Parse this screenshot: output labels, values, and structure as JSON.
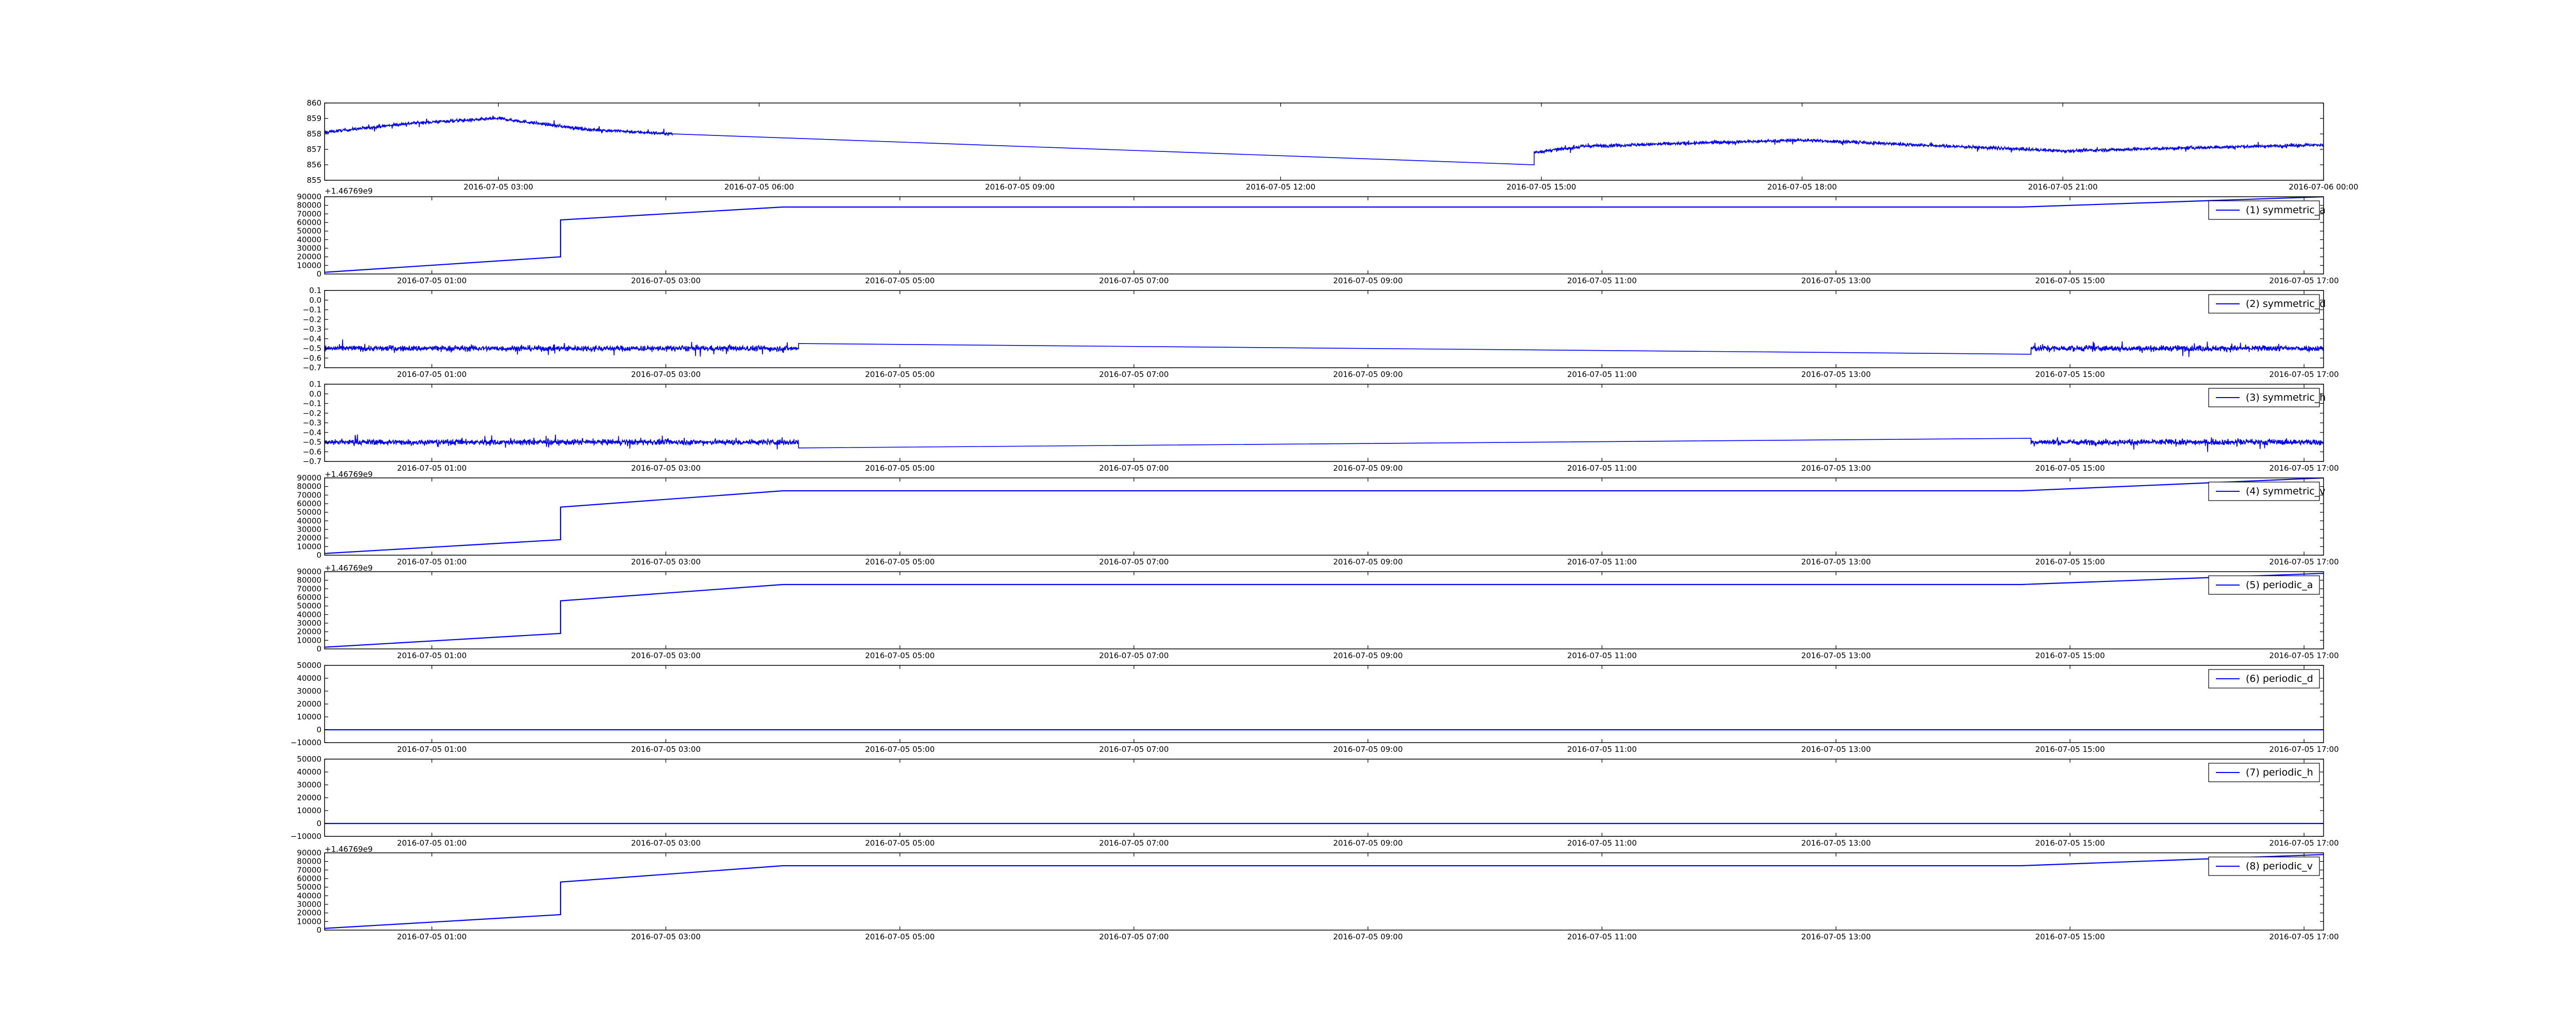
{
  "chart_data": [
    {
      "type": "line",
      "id": "raw",
      "yticks": [
        855,
        856,
        857,
        858,
        859,
        860
      ],
      "ylim": [
        855,
        860
      ],
      "xlim": [
        "2016-07-05T01:00",
        "2016-07-06T00:00"
      ],
      "xticks": [
        "2016-07-05 03:00",
        "2016-07-05 06:00",
        "2016-07-05 09:00",
        "2016-07-05 12:00",
        "2016-07-05 15:00",
        "2016-07-05 18:00",
        "2016-07-05 21:00",
        "2016-07-06 00:00"
      ],
      "offset_text": "+1.46769e9",
      "legend": "",
      "series": [
        {
          "color": "#0000ff",
          "noise": 0.18,
          "segments": [
            {
              "from": "2016-07-05T01:00",
              "to": "2016-07-05T05:00",
              "noisy": true,
              "x": [
                "2016-07-05T01:00",
                "2016-07-05T02:00",
                "2016-07-05T03:00",
                "2016-07-05T04:00",
                "2016-07-05T05:00"
              ],
              "y": [
                858.1,
                858.7,
                859.0,
                858.3,
                858.0
              ]
            },
            {
              "from": "2016-07-05T05:00",
              "to": "2016-07-05T14:55",
              "noisy": false,
              "x": [
                "2016-07-05T05:00",
                "2016-07-05T14:55"
              ],
              "y": [
                858.0,
                856.0
              ]
            },
            {
              "from": "2016-07-05T14:55",
              "to": "2016-07-06T00:00",
              "noisy": true,
              "x": [
                "2016-07-05T14:55",
                "2016-07-05T15:30",
                "2016-07-05T18:00",
                "2016-07-05T21:00",
                "2016-07-06T00:00"
              ],
              "y": [
                856.8,
                857.2,
                857.6,
                856.9,
                857.3
              ]
            }
          ]
        }
      ]
    },
    {
      "type": "line",
      "id": "1",
      "yticks": [
        0,
        10000,
        20000,
        30000,
        40000,
        50000,
        60000,
        70000,
        80000,
        90000
      ],
      "ylim": [
        0,
        90000
      ],
      "xlim": [
        "2016-07-05T00:05",
        "2016-07-05T17:10"
      ],
      "xticks": [
        "2016-07-05 01:00",
        "2016-07-05 03:00",
        "2016-07-05 05:00",
        "2016-07-05 07:00",
        "2016-07-05 09:00",
        "2016-07-05 11:00",
        "2016-07-05 13:00",
        "2016-07-05 15:00",
        "2016-07-05 17:00"
      ],
      "offset_text": "",
      "legend": "(1) symmetric_a",
      "series": [
        {
          "color": "#0000ff",
          "noise": 0,
          "x": [
            "2016-07-05T00:05",
            "2016-07-05T02:06",
            "2016-07-05T02:06",
            "2016-07-05T04:00",
            "2016-07-05T14:35",
            "2016-07-05T17:10"
          ],
          "y": [
            2000,
            20000,
            63000,
            78000,
            78000,
            90000
          ]
        }
      ]
    },
    {
      "type": "line",
      "id": "2",
      "yticks": [
        -0.7,
        -0.6,
        -0.5,
        -0.4,
        -0.3,
        -0.2,
        -0.1,
        0.0,
        0.1
      ],
      "ylim": [
        -0.7,
        0.1
      ],
      "xlim": [
        "2016-07-05T00:05",
        "2016-07-05T17:10"
      ],
      "xticks": [
        "2016-07-05 01:00",
        "2016-07-05 03:00",
        "2016-07-05 05:00",
        "2016-07-05 07:00",
        "2016-07-05 09:00",
        "2016-07-05 11:00",
        "2016-07-05 13:00",
        "2016-07-05 15:00",
        "2016-07-05 17:00"
      ],
      "offset_text": "",
      "legend": "(2) symmetric_d",
      "series": [
        {
          "color": "#0000ff",
          "noise": 0.05,
          "segments": [
            {
              "from": "2016-07-05T00:05",
              "to": "2016-07-05T04:08",
              "noisy": true,
              "x": [
                "2016-07-05T00:05",
                "2016-07-05T04:08"
              ],
              "y": [
                -0.5,
                -0.5
              ]
            },
            {
              "from": "2016-07-05T04:08",
              "to": "2016-07-05T14:40",
              "noisy": false,
              "x": [
                "2016-07-05T04:08",
                "2016-07-05T14:40"
              ],
              "y": [
                -0.45,
                -0.56
              ]
            },
            {
              "from": "2016-07-05T14:40",
              "to": "2016-07-05T17:10",
              "noisy": true,
              "x": [
                "2016-07-05T14:40",
                "2016-07-05T17:10"
              ],
              "y": [
                -0.5,
                -0.5
              ]
            }
          ]
        }
      ]
    },
    {
      "type": "line",
      "id": "3",
      "yticks": [
        -0.7,
        -0.6,
        -0.5,
        -0.4,
        -0.3,
        -0.2,
        -0.1,
        0.0,
        0.1
      ],
      "ylim": [
        -0.7,
        0.1
      ],
      "xlim": [
        "2016-07-05T00:05",
        "2016-07-05T17:10"
      ],
      "xticks": [
        "2016-07-05 01:00",
        "2016-07-05 03:00",
        "2016-07-05 05:00",
        "2016-07-05 07:00",
        "2016-07-05 09:00",
        "2016-07-05 11:00",
        "2016-07-05 13:00",
        "2016-07-05 15:00",
        "2016-07-05 17:00"
      ],
      "offset_text": "",
      "legend": "(3) symmetric_h",
      "series": [
        {
          "color": "#0000ff",
          "noise": 0.05,
          "segments": [
            {
              "from": "2016-07-05T00:05",
              "to": "2016-07-05T04:08",
              "noisy": true,
              "x": [
                "2016-07-05T00:05",
                "2016-07-05T04:08"
              ],
              "y": [
                -0.5,
                -0.5
              ]
            },
            {
              "from": "2016-07-05T04:08",
              "to": "2016-07-05T14:40",
              "noisy": false,
              "x": [
                "2016-07-05T04:08",
                "2016-07-05T14:40"
              ],
              "y": [
                -0.56,
                -0.46
              ]
            },
            {
              "from": "2016-07-05T14:40",
              "to": "2016-07-05T17:10",
              "noisy": true,
              "x": [
                "2016-07-05T14:40",
                "2016-07-05T17:10"
              ],
              "y": [
                -0.5,
                -0.5
              ]
            }
          ]
        }
      ]
    },
    {
      "type": "line",
      "id": "4",
      "yticks": [
        0,
        10000,
        20000,
        30000,
        40000,
        50000,
        60000,
        70000,
        80000,
        90000
      ],
      "ylim": [
        0,
        90000
      ],
      "xlim": [
        "2016-07-05T00:05",
        "2016-07-05T17:10"
      ],
      "xticks": [
        "2016-07-05 01:00",
        "2016-07-05 03:00",
        "2016-07-05 05:00",
        "2016-07-05 07:00",
        "2016-07-05 09:00",
        "2016-07-05 11:00",
        "2016-07-05 13:00",
        "2016-07-05 15:00",
        "2016-07-05 17:00"
      ],
      "offset_text": "+1.46769e9",
      "legend": "(4) symmetric_v",
      "series": [
        {
          "color": "#0000ff",
          "noise": 0,
          "x": [
            "2016-07-05T00:05",
            "2016-07-05T02:06",
            "2016-07-05T02:06",
            "2016-07-05T04:00",
            "2016-07-05T14:35",
            "2016-07-05T17:10"
          ],
          "y": [
            2000,
            18000,
            56000,
            75000,
            75000,
            90000
          ]
        }
      ]
    },
    {
      "type": "line",
      "id": "5",
      "yticks": [
        0,
        10000,
        20000,
        30000,
        40000,
        50000,
        60000,
        70000,
        80000,
        90000
      ],
      "ylim": [
        0,
        90000
      ],
      "xlim": [
        "2016-07-05T00:05",
        "2016-07-05T17:10"
      ],
      "xticks": [
        "2016-07-05 01:00",
        "2016-07-05 03:00",
        "2016-07-05 05:00",
        "2016-07-05 07:00",
        "2016-07-05 09:00",
        "2016-07-05 11:00",
        "2016-07-05 13:00",
        "2016-07-05 15:00",
        "2016-07-05 17:00"
      ],
      "offset_text": "+1.46769e9",
      "legend": "(5) periodic_a",
      "series": [
        {
          "color": "#0000ff",
          "noise": 0,
          "x": [
            "2016-07-05T00:05",
            "2016-07-05T02:06",
            "2016-07-05T02:06",
            "2016-07-05T04:00",
            "2016-07-05T14:35",
            "2016-07-05T17:10"
          ],
          "y": [
            2000,
            18000,
            56000,
            75000,
            75000,
            88000
          ]
        }
      ]
    },
    {
      "type": "line",
      "id": "6",
      "yticks": [
        -10000,
        0,
        10000,
        20000,
        30000,
        40000,
        50000
      ],
      "ylim": [
        -10000,
        50000
      ],
      "xlim": [
        "2016-07-05T00:05",
        "2016-07-05T17:10"
      ],
      "xticks": [
        "2016-07-05 01:00",
        "2016-07-05 03:00",
        "2016-07-05 05:00",
        "2016-07-05 07:00",
        "2016-07-05 09:00",
        "2016-07-05 11:00",
        "2016-07-05 13:00",
        "2016-07-05 15:00",
        "2016-07-05 17:00"
      ],
      "offset_text": "",
      "legend": "(6) periodic_d",
      "series": [
        {
          "color": "#0000ff",
          "noise": 0,
          "x": [
            "2016-07-05T00:05",
            "2016-07-05T17:10"
          ],
          "y": [
            0,
            0
          ]
        }
      ]
    },
    {
      "type": "line",
      "id": "7",
      "yticks": [
        -10000,
        0,
        10000,
        20000,
        30000,
        40000,
        50000
      ],
      "ylim": [
        -10000,
        50000
      ],
      "xlim": [
        "2016-07-05T00:05",
        "2016-07-05T17:10"
      ],
      "xticks": [
        "2016-07-05 01:00",
        "2016-07-05 03:00",
        "2016-07-05 05:00",
        "2016-07-05 07:00",
        "2016-07-05 09:00",
        "2016-07-05 11:00",
        "2016-07-05 13:00",
        "2016-07-05 15:00",
        "2016-07-05 17:00"
      ],
      "offset_text": "",
      "legend": "(7) periodic_h",
      "series": [
        {
          "color": "#0000ff",
          "noise": 0,
          "x": [
            "2016-07-05T00:05",
            "2016-07-05T17:10"
          ],
          "y": [
            0,
            0
          ]
        }
      ]
    },
    {
      "type": "line",
      "id": "8",
      "yticks": [
        0,
        10000,
        20000,
        30000,
        40000,
        50000,
        60000,
        70000,
        80000,
        90000
      ],
      "ylim": [
        0,
        90000
      ],
      "xlim": [
        "2016-07-05T00:05",
        "2016-07-05T17:10"
      ],
      "xticks": [
        "2016-07-05 01:00",
        "2016-07-05 03:00",
        "2016-07-05 05:00",
        "2016-07-05 07:00",
        "2016-07-05 09:00",
        "2016-07-05 11:00",
        "2016-07-05 13:00",
        "2016-07-05 15:00",
        "2016-07-05 17:00"
      ],
      "offset_text": "+1.46769e9",
      "legend": "(8) periodic_v",
      "series": [
        {
          "color": "#0000ff",
          "noise": 0,
          "x": [
            "2016-07-05T00:05",
            "2016-07-05T02:06",
            "2016-07-05T02:06",
            "2016-07-05T04:00",
            "2016-07-05T14:35",
            "2016-07-05T17:10"
          ],
          "y": [
            2000,
            18000,
            56000,
            75000,
            75000,
            88000
          ]
        }
      ]
    }
  ]
}
